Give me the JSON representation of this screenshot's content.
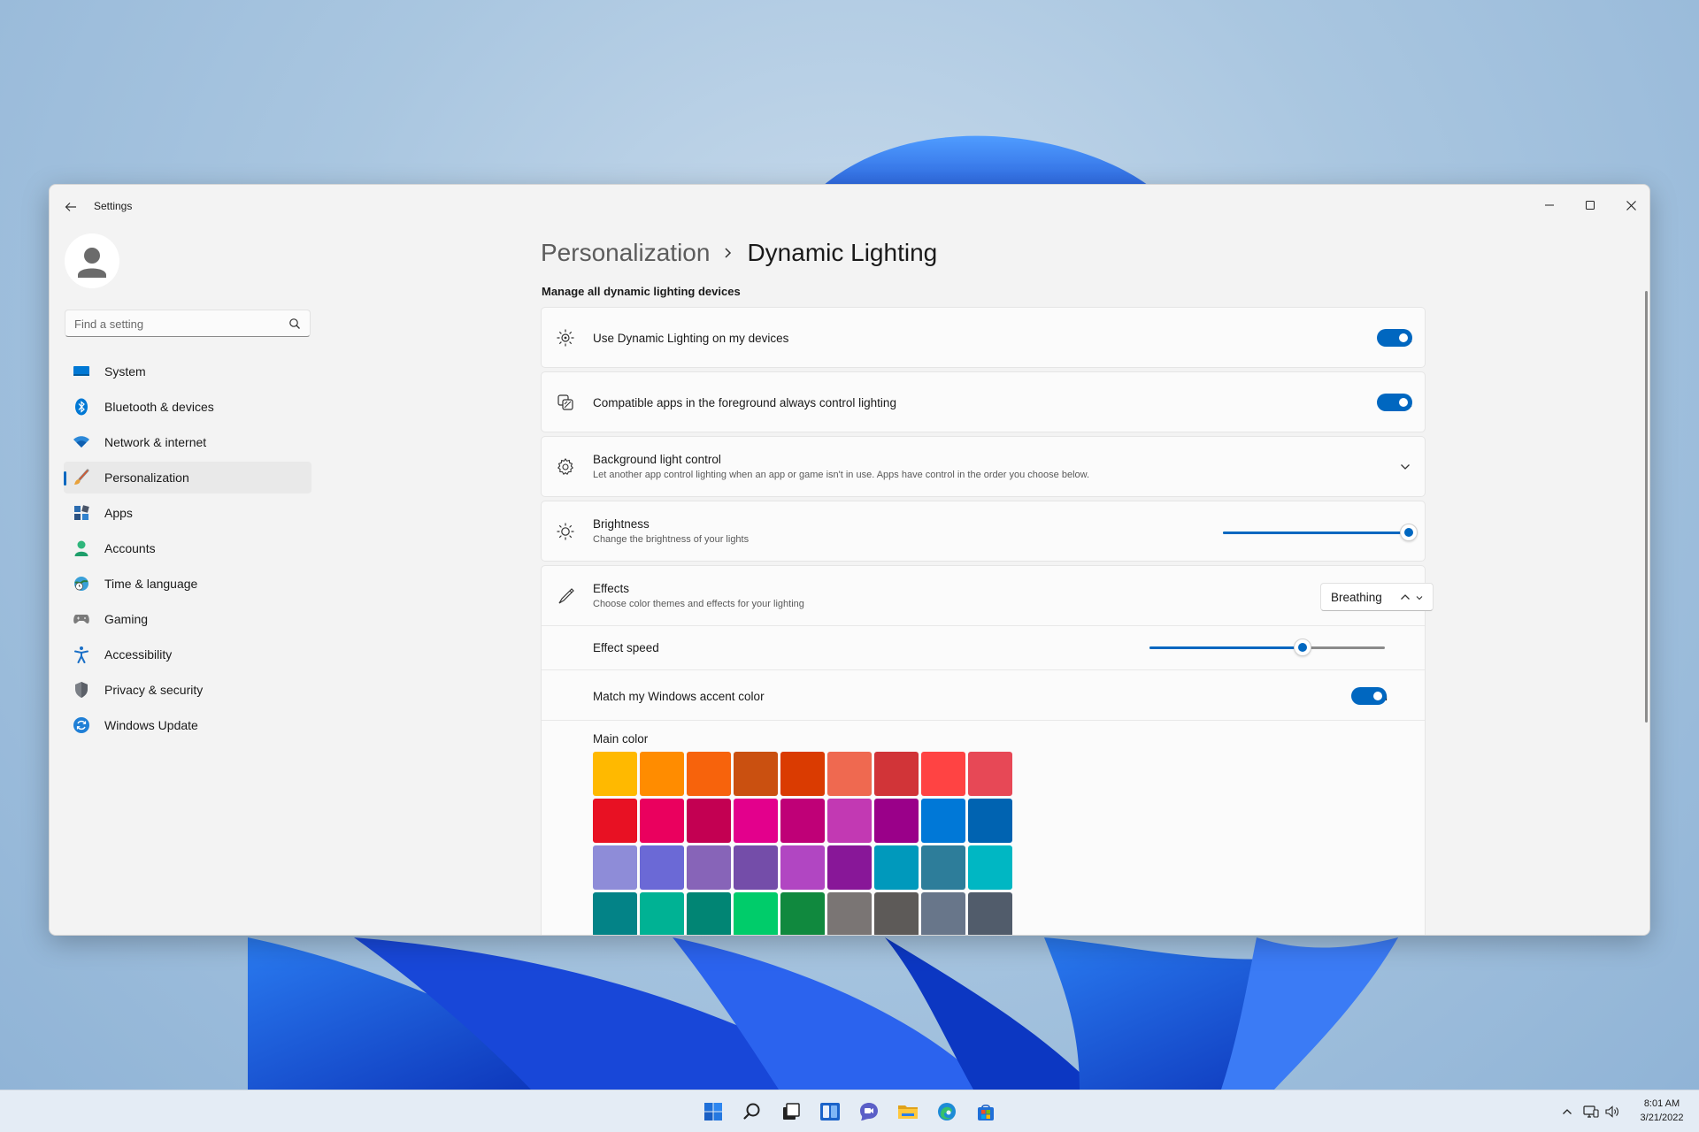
{
  "window": {
    "title": "Settings"
  },
  "search": {
    "placeholder": "Find a setting"
  },
  "sidebar": {
    "items": [
      {
        "label": "System",
        "icon": "system-icon"
      },
      {
        "label": "Bluetooth & devices",
        "icon": "bluetooth-icon"
      },
      {
        "label": "Network & internet",
        "icon": "wifi-icon"
      },
      {
        "label": "Personalization",
        "icon": "brush-icon",
        "active": true
      },
      {
        "label": "Apps",
        "icon": "apps-icon"
      },
      {
        "label": "Accounts",
        "icon": "person-icon"
      },
      {
        "label": "Time & language",
        "icon": "globe-clock-icon"
      },
      {
        "label": "Gaming",
        "icon": "gamepad-icon"
      },
      {
        "label": "Accessibility",
        "icon": "accessibility-icon"
      },
      {
        "label": "Privacy & security",
        "icon": "shield-icon"
      },
      {
        "label": "Windows Update",
        "icon": "update-icon"
      }
    ]
  },
  "breadcrumb": {
    "parent": "Personalization",
    "current": "Dynamic Lighting"
  },
  "main": {
    "section_title": "Manage all dynamic lighting devices",
    "use_dynamic": {
      "title": "Use Dynamic Lighting on my devices",
      "state": "On",
      "on": true
    },
    "foreground_apps": {
      "title": "Compatible apps in the foreground always control lighting",
      "state": "On",
      "on": true
    },
    "background": {
      "title": "Background light control",
      "subtitle": "Let another app control lighting when an app or game isn't in use. Apps have control in the order you choose below."
    },
    "brightness": {
      "title": "Brightness",
      "subtitle": "Change the brightness of your lights",
      "value_percent": 100
    },
    "effects": {
      "title": "Effects",
      "subtitle": "Choose color themes and effects for your lighting",
      "selected": "Breathing",
      "speed_label": "Effect speed",
      "speed_percent": 65,
      "accent_label": "Match my Windows accent color",
      "accent_state": "On",
      "main_color_label": "Main color",
      "swatches": [
        "#ffb900",
        "#ff8c00",
        "#f7630c",
        "#ca5010",
        "#da3b01",
        "#ef6950",
        "#d13438",
        "#ff4343",
        "#e74856",
        "#e81123",
        "#ea005e",
        "#c30052",
        "#e3008c",
        "#bf0077",
        "#c239b3",
        "#9a0089",
        "#0078d7",
        "#0063b1",
        "#8e8cd8",
        "#6b69d6",
        "#8764b8",
        "#744da9",
        "#b146c2",
        "#881798",
        "#0099bc",
        "#2d7d9a",
        "#00b7c3",
        "#038387",
        "#00b294",
        "#018574",
        "#00cc6a",
        "#10893e",
        "#7a7574",
        "#5d5a58",
        "#68768a",
        "#515c6b"
      ]
    }
  },
  "taskbar": {
    "apps": [
      "windows-start-icon",
      "search-icon",
      "task-view-icon",
      "widgets-icon",
      "chat-icon",
      "file-explorer-icon",
      "edge-icon",
      "store-icon"
    ],
    "time": "8:01 AM",
    "date": "3/21/2022"
  },
  "colors": {
    "accent": "#0067c0"
  }
}
